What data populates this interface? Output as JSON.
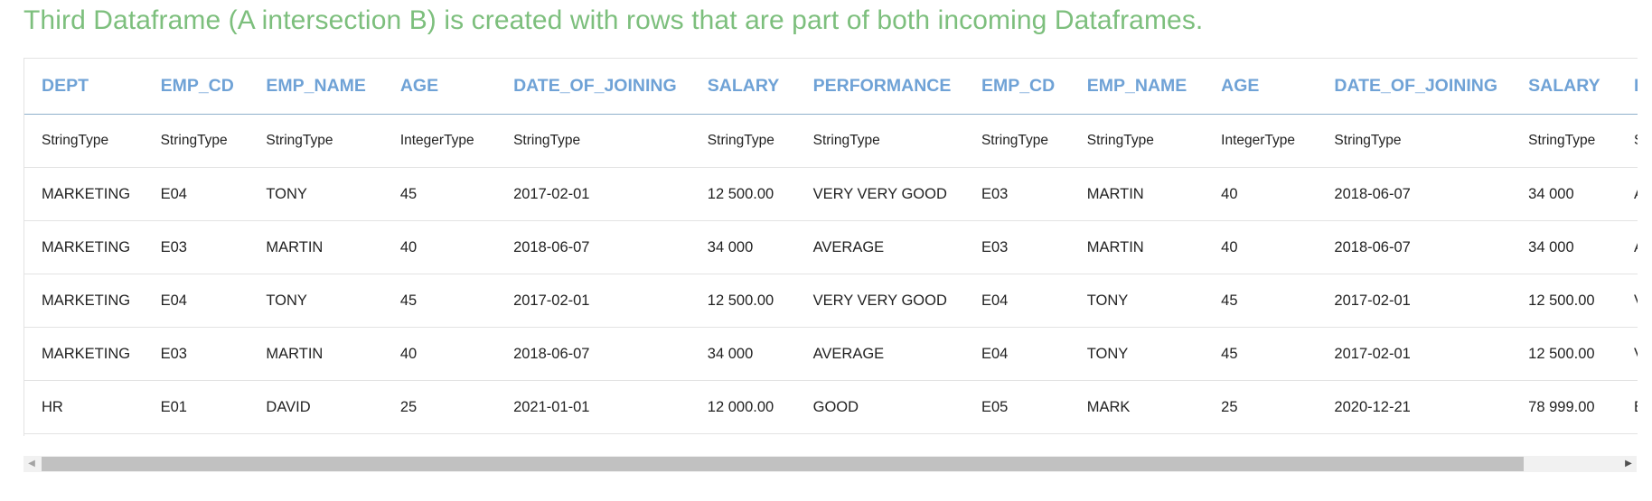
{
  "title": "Third Dataframe (A intersection B) is created with rows that are part of both incoming Dataframes.",
  "table": {
    "headers": [
      "DEPT",
      "EMP_CD",
      "EMP_NAME",
      "AGE",
      "DATE_OF_JOINING",
      "SALARY",
      "PERFORMANCE",
      "EMP_CD",
      "EMP_NAME",
      "AGE",
      "DATE_OF_JOINING",
      "SALARY",
      "PERFORMANCE"
    ],
    "types": [
      "StringType",
      "StringType",
      "StringType",
      "IntegerType",
      "StringType",
      "StringType",
      "StringType",
      "StringType",
      "StringType",
      "IntegerType",
      "StringType",
      "StringType",
      "StringType"
    ],
    "rows": [
      [
        "MARKETING",
        "E04",
        "TONY",
        "45",
        "2017-02-01",
        "12 500.00",
        "VERY VERY GOOD",
        "E03",
        "MARTIN",
        "40",
        "2018-06-07",
        "34 000",
        "AVERAGE"
      ],
      [
        "MARKETING",
        "E03",
        "MARTIN",
        "40",
        "2018-06-07",
        "34 000",
        "AVERAGE",
        "E03",
        "MARTIN",
        "40",
        "2018-06-07",
        "34 000",
        "AVERAGE"
      ],
      [
        "MARKETING",
        "E04",
        "TONY",
        "45",
        "2017-02-01",
        "12 500.00",
        "VERY VERY GOOD",
        "E04",
        "TONY",
        "45",
        "2017-02-01",
        "12 500.00",
        "VERY VERY GOOD"
      ],
      [
        "MARKETING",
        "E03",
        "MARTIN",
        "40",
        "2018-06-07",
        "34 000",
        "AVERAGE",
        "E04",
        "TONY",
        "45",
        "2017-02-01",
        "12 500.00",
        "VERY VERY GOOD"
      ],
      [
        "HR",
        "E01",
        "DAVID",
        "25",
        "2021-01-01",
        "12 000.00",
        "GOOD",
        "E05",
        "MARK",
        "25",
        "2020-12-21",
        "78 999.00",
        "BAD"
      ]
    ]
  },
  "scrollbar": {
    "left_arrow": "◀",
    "right_arrow": "▶",
    "thumb_fraction": 0.94
  }
}
